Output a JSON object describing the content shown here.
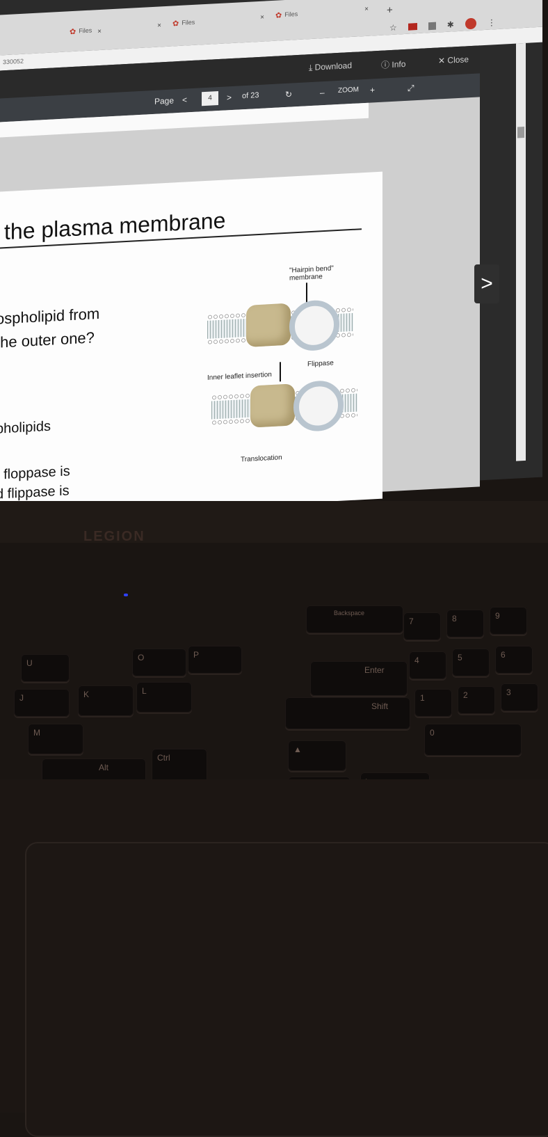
{
  "browser": {
    "tabs": [
      {
        "label": "Files"
      },
      {
        "label": "Files"
      },
      {
        "label": "Files"
      }
    ],
    "tab_close": "×",
    "new_tab": "+",
    "url_fragment": "330052",
    "star_icon": "☆"
  },
  "viewer": {
    "download_label": "Download",
    "info_label": "Info",
    "close_label": "Close",
    "page_label": "Page",
    "current_page": "4",
    "of_pages": "of 23",
    "zoom_label": "ZOOM",
    "zoom_minus": "–",
    "zoom_plus": "+",
    "prev": "<",
    "next": ">",
    "next_page_arrow": ">"
  },
  "slide": {
    "title": "the plasma membrane",
    "lines": [
      "ospholipid from",
      "the outer one?",
      "pholipids",
      "t floppase is",
      "d flippase is"
    ],
    "figure": {
      "hairpin_label": "\"Hairpin bend\"",
      "hairpin_label2": "membrane",
      "inner_leaflet": "Inner leaflet insertion",
      "flippase": "Flippase",
      "translocation": "Translocation"
    }
  },
  "laptop": {
    "brand": "LEGION",
    "keys": [
      {
        "label": "U"
      },
      {
        "label": "J"
      },
      {
        "label": "M"
      },
      {
        "label": "K"
      },
      {
        "label": "L"
      },
      {
        "label": "O"
      },
      {
        "label": "P"
      },
      {
        "label": "Enter"
      },
      {
        "label": "Shift"
      },
      {
        "label": "Backspace"
      },
      {
        "label": "Alt"
      },
      {
        "label": "Ctrl"
      },
      {
        "label": "7"
      },
      {
        "label": "8"
      },
      {
        "label": "9"
      },
      {
        "label": "4"
      },
      {
        "label": "5"
      },
      {
        "label": "6"
      },
      {
        "label": "1"
      },
      {
        "label": "2"
      },
      {
        "label": "3"
      },
      {
        "label": "0"
      }
    ]
  }
}
